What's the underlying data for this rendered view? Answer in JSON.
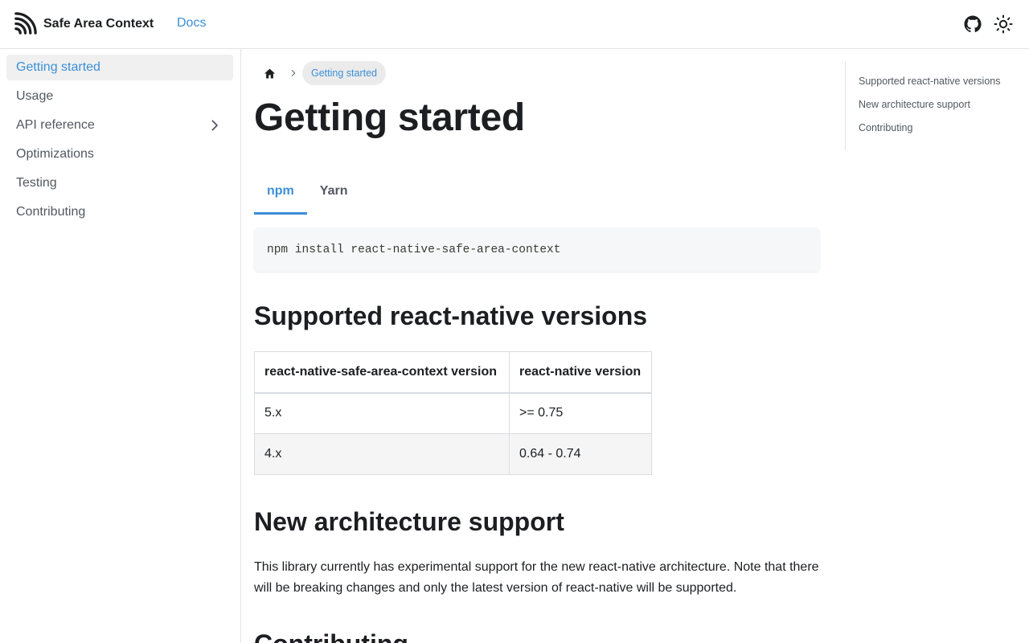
{
  "navbar": {
    "brand_title": "Safe Area Context",
    "docs_link": "Docs",
    "icons": {
      "logo": "wifi-logo-icon",
      "github": "github-icon",
      "theme": "sun-icon"
    }
  },
  "sidebar": {
    "items": [
      {
        "label": "Getting started",
        "active": true
      },
      {
        "label": "Usage"
      },
      {
        "label": "API reference",
        "has_children": true
      },
      {
        "label": "Optimizations"
      },
      {
        "label": "Testing"
      },
      {
        "label": "Contributing"
      }
    ]
  },
  "breadcrumb": {
    "home_icon": "home-icon",
    "current": "Getting started"
  },
  "page": {
    "title": "Getting started",
    "tabs": [
      {
        "label": "npm",
        "active": true
      },
      {
        "label": "Yarn"
      }
    ],
    "code": "npm install react-native-safe-area-context",
    "sections": {
      "supported": "Supported react-native versions",
      "architecture": "New architecture support",
      "contributing": "Contributing"
    },
    "versions_table": {
      "headers": [
        "react-native-safe-area-context version",
        "react-native version"
      ],
      "rows": [
        [
          "5.x",
          ">= 0.75"
        ],
        [
          "4.x",
          "0.64 - 0.74"
        ]
      ]
    },
    "architecture_text": "This library currently has experimental support for the new react-native architecture. Note that there will be breaking changes and only the latest version of react-native will be supported."
  },
  "toc": {
    "items": [
      "Supported react-native versions",
      "New architecture support",
      "Contributing"
    ]
  },
  "colors": {
    "accent": "#3b8fd8",
    "text": "#1c1e21",
    "muted": "#525860",
    "border": "#e3e3e3"
  }
}
